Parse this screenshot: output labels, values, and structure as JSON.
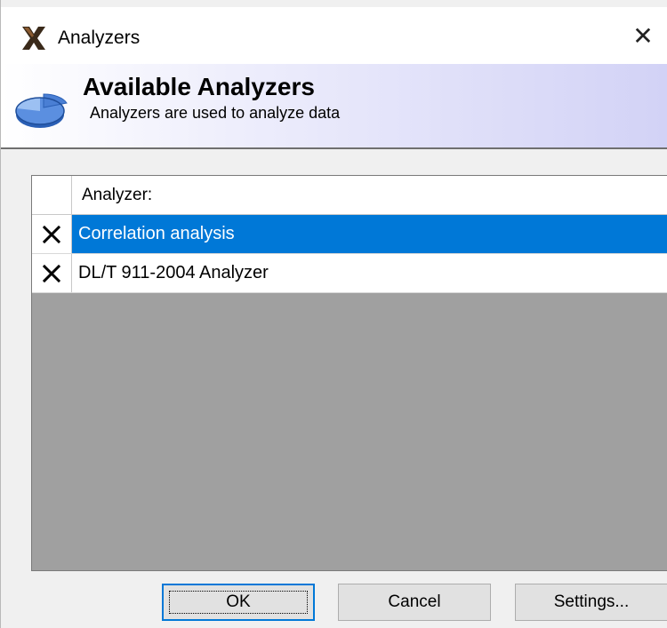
{
  "window": {
    "title": "Analyzers",
    "close_glyph": "✕"
  },
  "banner": {
    "title": "Available Analyzers",
    "subtitle": "Analyzers are used to analyze data",
    "icon": "pie-chart-icon"
  },
  "grid": {
    "column_header": "Analyzer:",
    "rows": [
      {
        "name": "Correlation analysis",
        "disabled_mark": "✕",
        "selected": true
      },
      {
        "name": "DL/T 911-2004 Analyzer",
        "disabled_mark": "✕",
        "selected": false
      }
    ]
  },
  "buttons": {
    "ok": "OK",
    "cancel": "Cancel",
    "settings": "Settings..."
  },
  "colors": {
    "selection": "#0078d7",
    "grid_background": "#a0a0a0",
    "banner_gradient_end": "#d2d2f6"
  }
}
